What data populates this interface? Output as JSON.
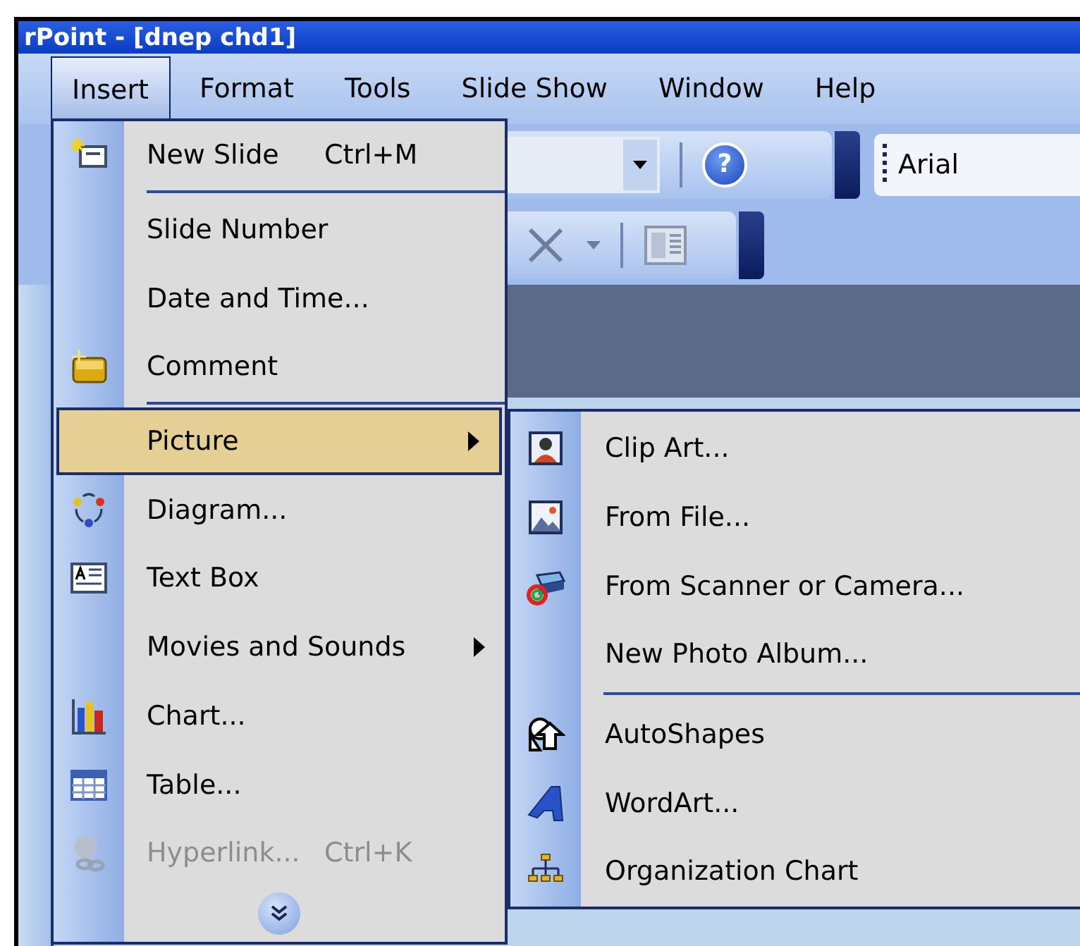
{
  "window": {
    "title": "rPoint - [dnep chd1]"
  },
  "menu_bar": [
    {
      "label": "Insert",
      "selected": true
    },
    {
      "label": "Format",
      "selected": false
    },
    {
      "label": "Tools",
      "selected": false
    },
    {
      "label": "Slide Show",
      "selected": false
    },
    {
      "label": "Window",
      "selected": false
    },
    {
      "label": "Help",
      "selected": false
    }
  ],
  "toolbar": {
    "help_glyph": "?",
    "font_name": "Arial"
  },
  "insert_menu": {
    "items": [
      {
        "kind": "item",
        "label": "New Slide",
        "shortcut": "Ctrl+M",
        "selected": false,
        "disabled": false,
        "has_submenu": false
      },
      {
        "kind": "separator"
      },
      {
        "kind": "item",
        "label": "Slide Number",
        "selected": false,
        "disabled": false,
        "has_submenu": false
      },
      {
        "kind": "item",
        "label": "Date and Time...",
        "selected": false,
        "disabled": false,
        "has_submenu": false
      },
      {
        "kind": "item",
        "label": "Comment",
        "selected": false,
        "disabled": false,
        "has_submenu": false
      },
      {
        "kind": "separator"
      },
      {
        "kind": "item",
        "label": "Picture",
        "selected": true,
        "disabled": false,
        "has_submenu": true
      },
      {
        "kind": "item",
        "label": "Diagram...",
        "selected": false,
        "disabled": false,
        "has_submenu": false
      },
      {
        "kind": "item",
        "label": "Text Box",
        "selected": false,
        "disabled": false,
        "has_submenu": false
      },
      {
        "kind": "item",
        "label": "Movies and Sounds",
        "selected": false,
        "disabled": false,
        "has_submenu": true
      },
      {
        "kind": "item",
        "label": "Chart...",
        "selected": false,
        "disabled": false,
        "has_submenu": false
      },
      {
        "kind": "item",
        "label": "Table...",
        "selected": false,
        "disabled": false,
        "has_submenu": false
      },
      {
        "kind": "item",
        "label": "Hyperlink...",
        "shortcut": "Ctrl+K",
        "selected": false,
        "disabled": true,
        "has_submenu": false
      },
      {
        "kind": "more"
      }
    ]
  },
  "picture_submenu": {
    "items": [
      {
        "kind": "item",
        "label": "Clip Art..."
      },
      {
        "kind": "item",
        "label": "From File..."
      },
      {
        "kind": "item",
        "label": "From Scanner or Camera..."
      },
      {
        "kind": "item",
        "label": "New Photo Album..."
      },
      {
        "kind": "separator"
      },
      {
        "kind": "item",
        "label": "AutoShapes"
      },
      {
        "kind": "item",
        "label": "WordArt..."
      },
      {
        "kind": "item",
        "label": "Organization Chart"
      }
    ]
  }
}
